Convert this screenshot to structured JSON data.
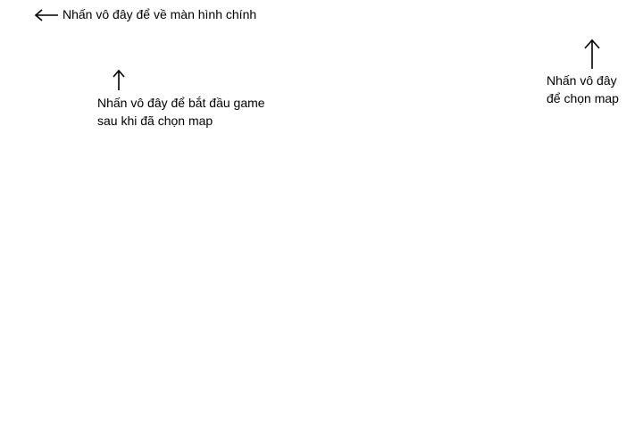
{
  "hints": {
    "home": {
      "text": "Nhấn vô đây để về màn hình chính",
      "icon": "arrow-left-icon"
    },
    "start": {
      "line1": "Nhấn vô đây để bắt đầu game",
      "line2": "sau khi đã chọn map",
      "icon": "arrow-up-icon"
    },
    "map": {
      "line1": "Nhấn vô đây",
      "line2": "để chọn map",
      "icon": "arrow-up-icon"
    }
  }
}
